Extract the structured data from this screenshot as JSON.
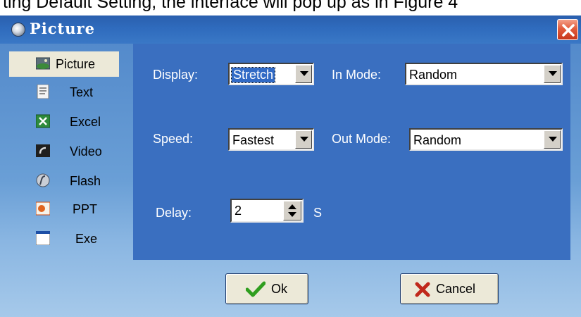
{
  "caption": "ting Default Setting, the interface will pop up as in Figure 4",
  "window": {
    "title": "Picture"
  },
  "sidebar": {
    "items": [
      {
        "label": "Picture",
        "icon": "picture-icon",
        "selected": true
      },
      {
        "label": "Text",
        "icon": "text-icon",
        "selected": false
      },
      {
        "label": "Excel",
        "icon": "excel-icon",
        "selected": false
      },
      {
        "label": "Video",
        "icon": "video-icon",
        "selected": false
      },
      {
        "label": "Flash",
        "icon": "flash-icon",
        "selected": false
      },
      {
        "label": "PPT",
        "icon": "ppt-icon",
        "selected": false
      },
      {
        "label": "Exe",
        "icon": "exe-icon",
        "selected": false
      }
    ]
  },
  "settings": {
    "display": {
      "label": "Display:",
      "value": "Stretch"
    },
    "in_mode": {
      "label": "In Mode:",
      "value": "Random"
    },
    "speed": {
      "label": "Speed:",
      "value": "Fastest"
    },
    "out_mode": {
      "label": "Out Mode:",
      "value": "Random"
    },
    "delay": {
      "label": "Delay:",
      "value": "2",
      "unit": "S"
    }
  },
  "buttons": {
    "ok": "Ok",
    "cancel": "Cancel"
  },
  "colors": {
    "titlebar": "#2f6bbd",
    "panel": "#3a6fc0",
    "close": "#e25c3c",
    "ok_check": "#2f9e1f",
    "cancel_x": "#c0281b"
  }
}
